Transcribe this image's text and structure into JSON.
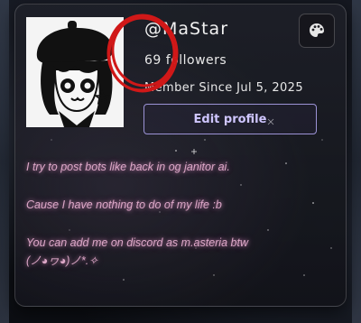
{
  "profile": {
    "username": "@MaStar",
    "followers": "69 followers",
    "member_since": "Member Since Jul 5, 2025",
    "edit_label": "Edit profile",
    "palette_icon": "palette-icon"
  },
  "bio": {
    "line1": "I try to post bots like back in og janitor ai.",
    "line2": "Cause I have nothing to do of my life :b",
    "line3": "You can add me on discord as m.asteria btw",
    "line4": "(ノ◕ヮ◕)ノ*.✧"
  },
  "colors": {
    "accent": "#9c93d6",
    "bio_glow": "#dca7c7",
    "annotation_red": "#d01818"
  }
}
